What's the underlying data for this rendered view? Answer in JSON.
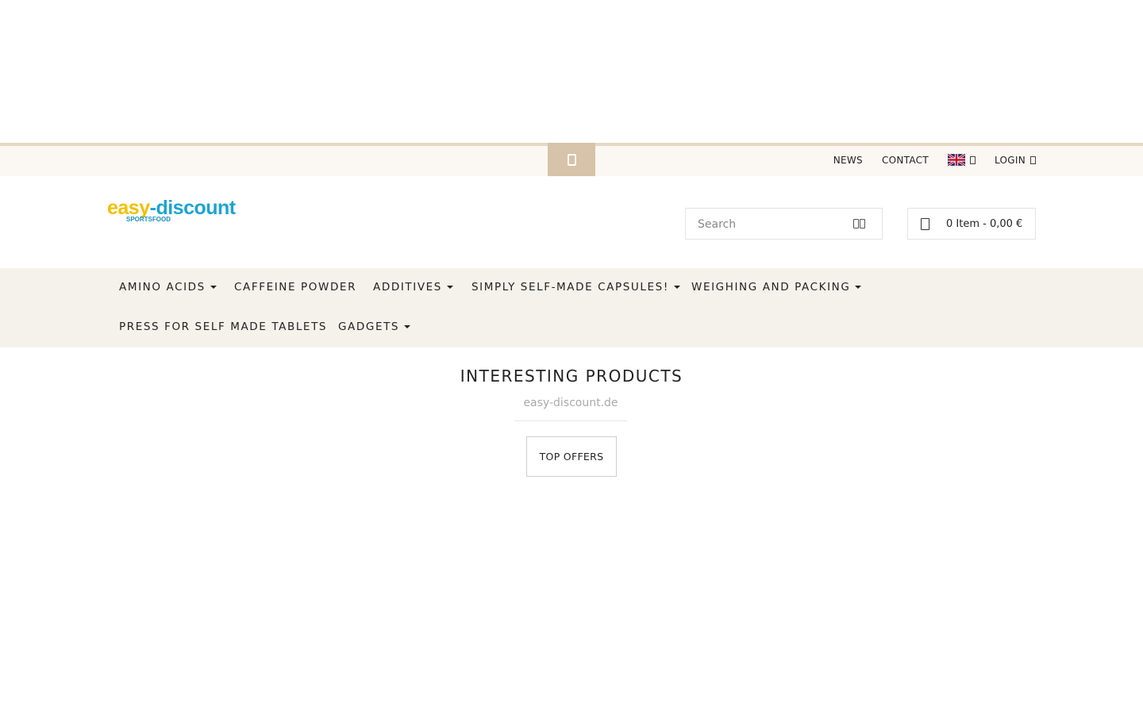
{
  "topbar": {
    "toggle_icon": "mobile-icon",
    "links": {
      "news": "NEWS",
      "contact": "CONTACT",
      "language_flag": "uk-flag-icon",
      "login": "LOGIN"
    }
  },
  "header": {
    "logo": {
      "part1": "easy",
      "part2": "-discount",
      "tagline": "SPORTSFOOD"
    },
    "search": {
      "placeholder": "Search",
      "icon": "search-icon"
    },
    "cart": {
      "icon": "cart-icon",
      "summary": "0 Item - 0,00 €"
    }
  },
  "nav": {
    "items": [
      {
        "label": "AMINO ACIDS",
        "dropdown": true
      },
      {
        "label": "CAFFEINE POWDER",
        "dropdown": false
      },
      {
        "label": "ADDITIVES",
        "dropdown": true
      },
      {
        "label": "SIMPLY SELF-MADE CAPSULES!",
        "dropdown": true
      },
      {
        "label": "WEIGHING AND PACKING",
        "dropdown": true
      },
      {
        "label": "PRESS FOR SELF MADE TABLETS",
        "dropdown": false
      },
      {
        "label": "GADGETS",
        "dropdown": true
      }
    ]
  },
  "main": {
    "title": "INTERESTING PRODUCTS",
    "subtitle": "easy-discount.de",
    "tabs": [
      {
        "label": "TOP OFFERS"
      }
    ]
  },
  "colors": {
    "accent": "#d7c3a9",
    "nav_bg": "#f5f2ec",
    "topbar_bg": "#fbf8f3",
    "logo_yellow": "#f0c000",
    "logo_blue": "#1da3d1"
  }
}
